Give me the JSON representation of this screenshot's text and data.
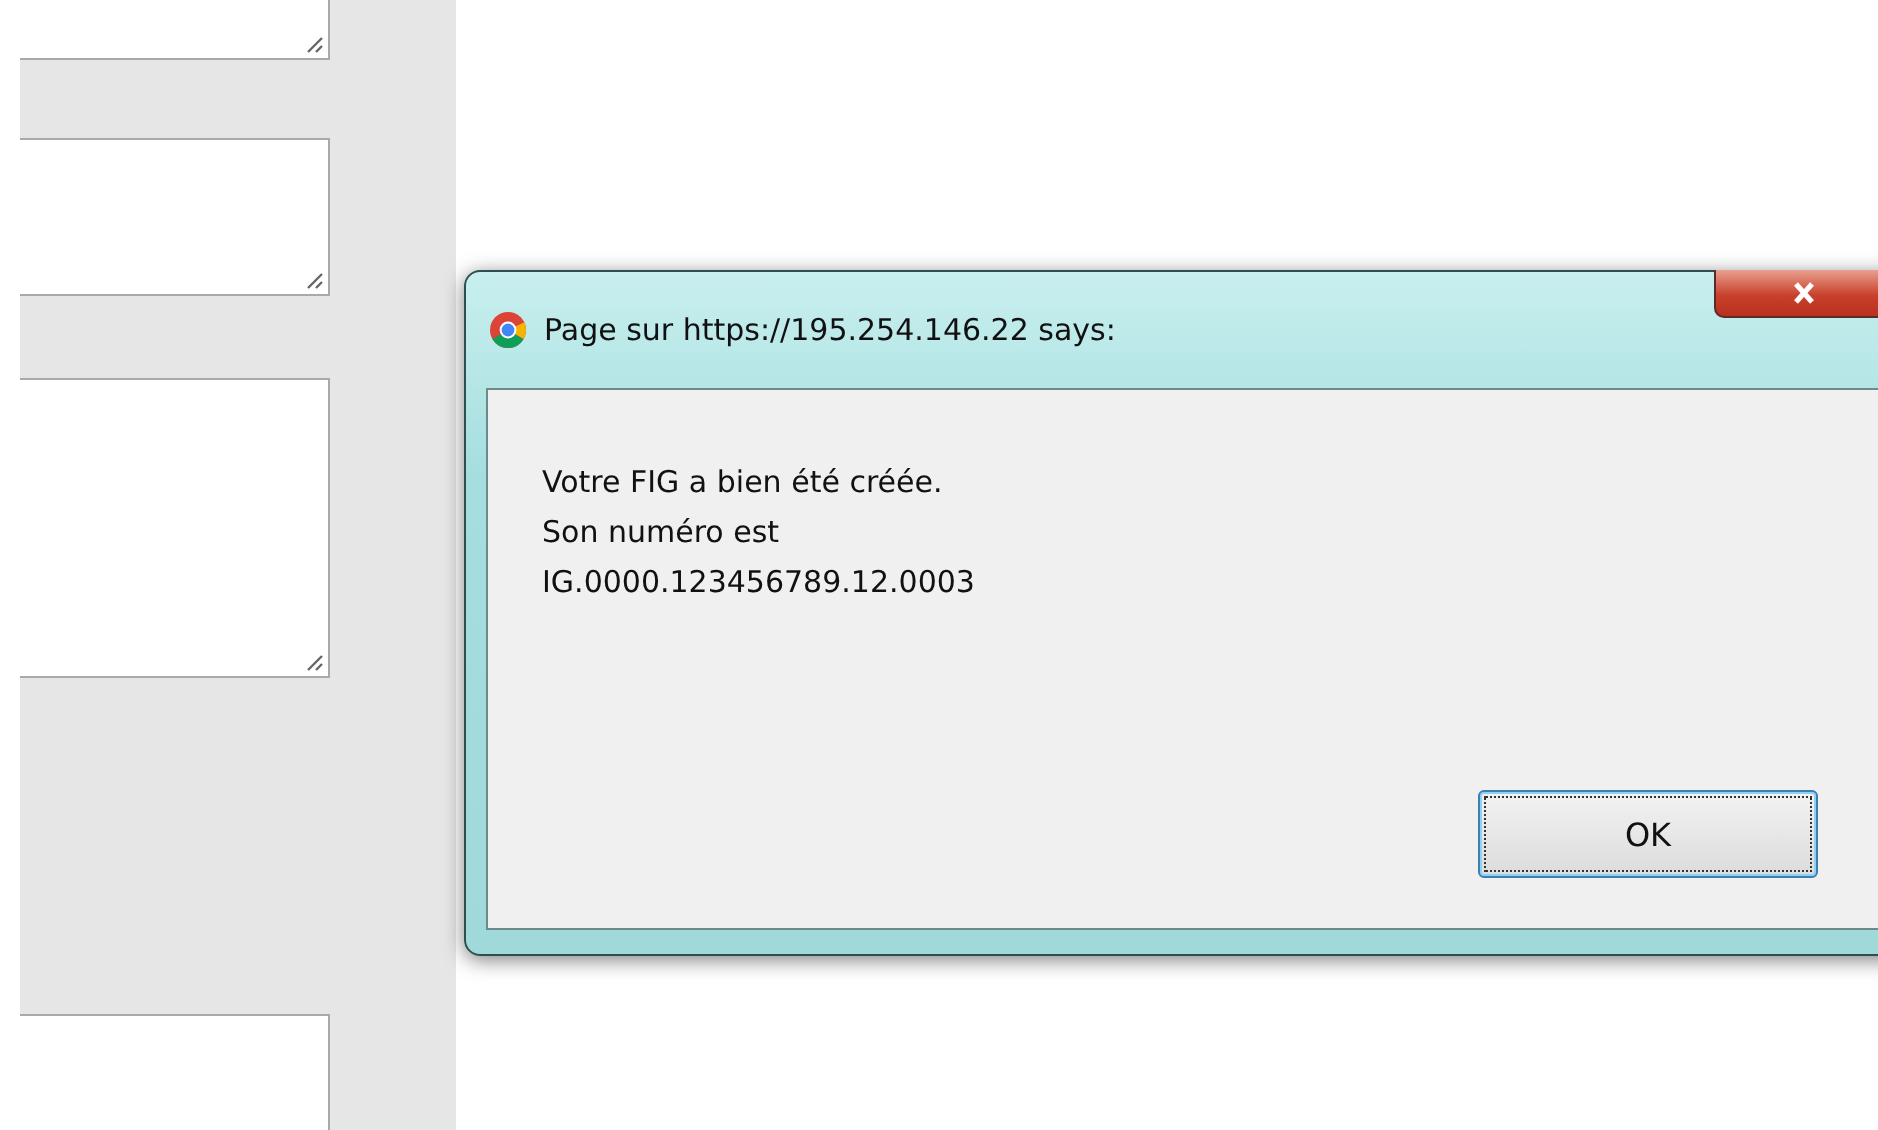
{
  "form": {
    "text_areas": [
      {
        "kind": "partial"
      },
      {
        "kind": "short"
      },
      {
        "kind": "tall"
      },
      {
        "kind": "partial"
      }
    ]
  },
  "dialog": {
    "title": "Page sur https://195.254.146.22 says:",
    "message_lines": [
      "Votre FIG a bien été créée.",
      "Son numéro est",
      "IG.0000.123456789.12.0003"
    ],
    "ok_button": {
      "label": "OK",
      "focused": true
    }
  }
}
